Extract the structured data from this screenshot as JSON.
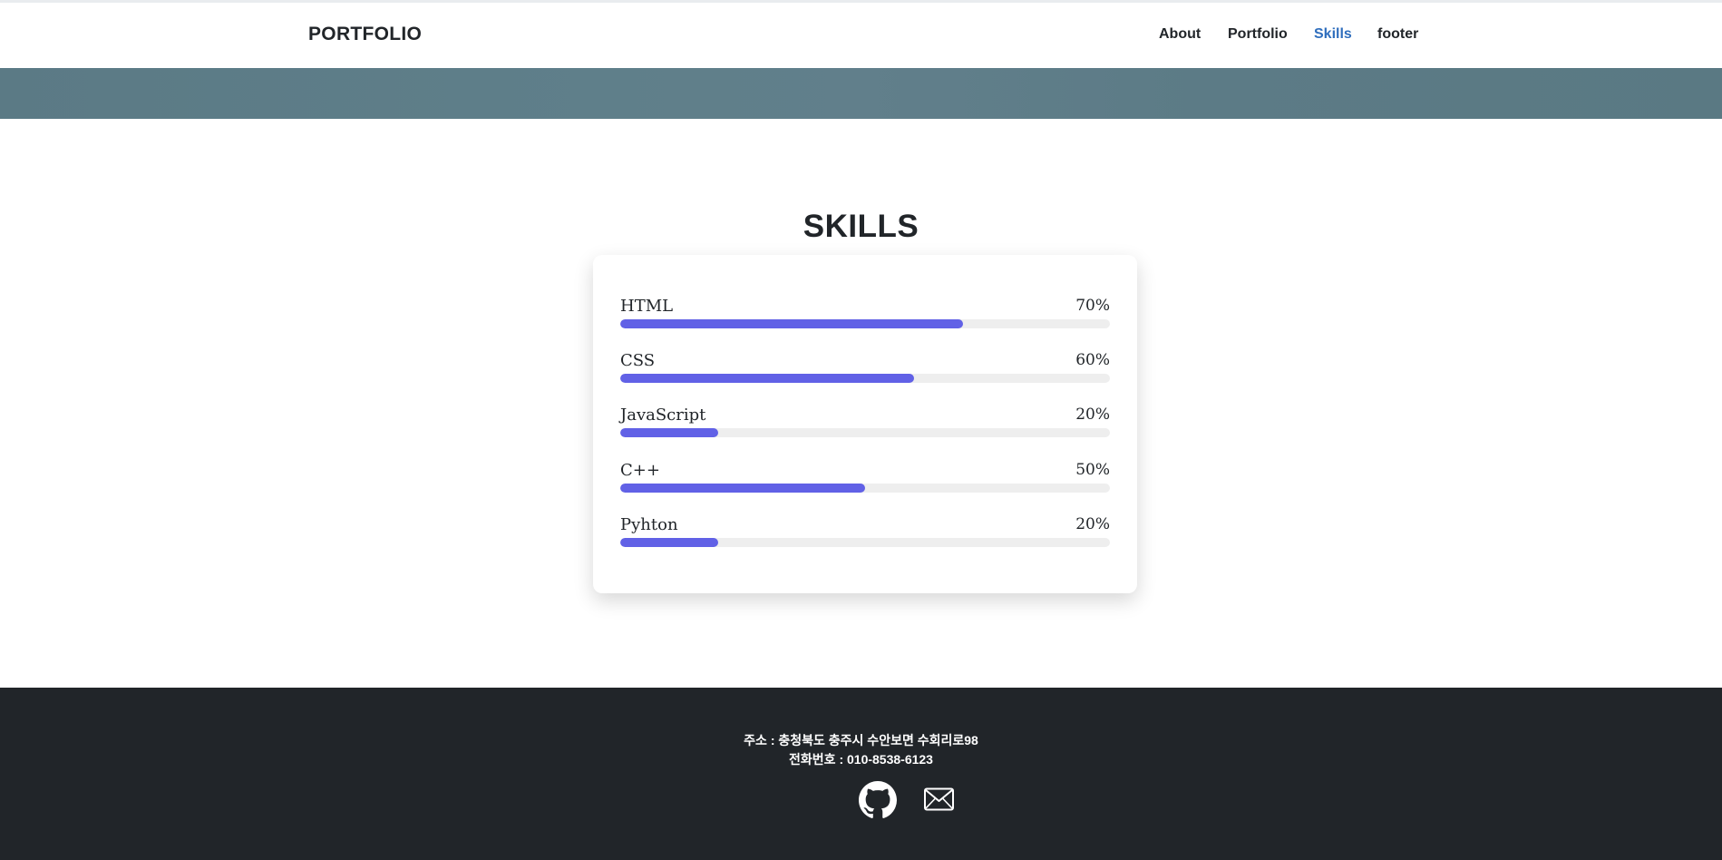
{
  "navbar": {
    "brand": "PORTFOLIO",
    "links": [
      {
        "label": "About",
        "active": false
      },
      {
        "label": "Portfolio",
        "active": false
      },
      {
        "label": "Skills",
        "active": true
      },
      {
        "label": "footer",
        "active": false
      }
    ]
  },
  "skills": {
    "title": "SKILLS",
    "items": [
      {
        "name": "HTML",
        "percent_label": "70%",
        "level": 0.7
      },
      {
        "name": "CSS",
        "percent_label": "60%",
        "level": 0.6
      },
      {
        "name": "JavaScript",
        "percent_label": "20%",
        "level": 0.2
      },
      {
        "name": "C++",
        "percent_label": "50%",
        "level": 0.5
      },
      {
        "name": "Pyhton",
        "percent_label": "20%",
        "level": 0.2
      }
    ],
    "bar_color": "#6161e6",
    "track_color": "#eeeeee"
  },
  "footer": {
    "address": "주소 : 충청북도 충주시 수안보면 수회리로98",
    "phone": "전화번호 : 010-8538-6123",
    "icons": [
      "github-icon",
      "mail-icon"
    ]
  },
  "colors": {
    "accent": "#2f6ebd",
    "footer_bg": "#212529",
    "hero_strip": "#5f7f8a"
  }
}
